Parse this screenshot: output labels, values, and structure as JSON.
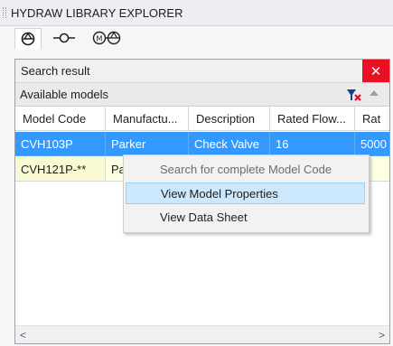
{
  "window": {
    "title": "HYDRAW LIBRARY EXPLORER"
  },
  "toolbar": {
    "buttons": [
      {
        "icon": "valve-symbol-icon",
        "active": true
      },
      {
        "icon": "line-connector-icon",
        "active": false
      },
      {
        "icon": "motor-pump-icon",
        "active": false
      }
    ]
  },
  "panel": {
    "title": "Search result",
    "close_label": "✕",
    "subheader": "Available models",
    "clear_icon": "clear-filter-icon",
    "collapse_icon": "collapse-up-icon"
  },
  "grid": {
    "columns": [
      "Model Code",
      "Manufactu...",
      "Description",
      "Rated Flow...",
      "Rat"
    ],
    "rows": [
      {
        "cells": [
          "CVH103P",
          "Parker",
          "Check Valve",
          "16",
          "5000"
        ],
        "selected": true
      },
      {
        "cells": [
          "CVH121P-**",
          "Pa",
          "",
          "",
          ""
        ],
        "selected": false
      }
    ]
  },
  "scrollbar": {
    "left_arrow": "<",
    "right_arrow": ">"
  },
  "context_menu": {
    "items": [
      {
        "label": "Search for complete Model Code",
        "enabled": false
      },
      {
        "label": "View Model Properties",
        "enabled": true,
        "highlighted": true
      },
      {
        "label": "View Data Sheet",
        "enabled": true
      }
    ]
  },
  "colors": {
    "selection": "#3399ff",
    "close": "#e81123",
    "menu_highlight": "#cce8ff"
  }
}
